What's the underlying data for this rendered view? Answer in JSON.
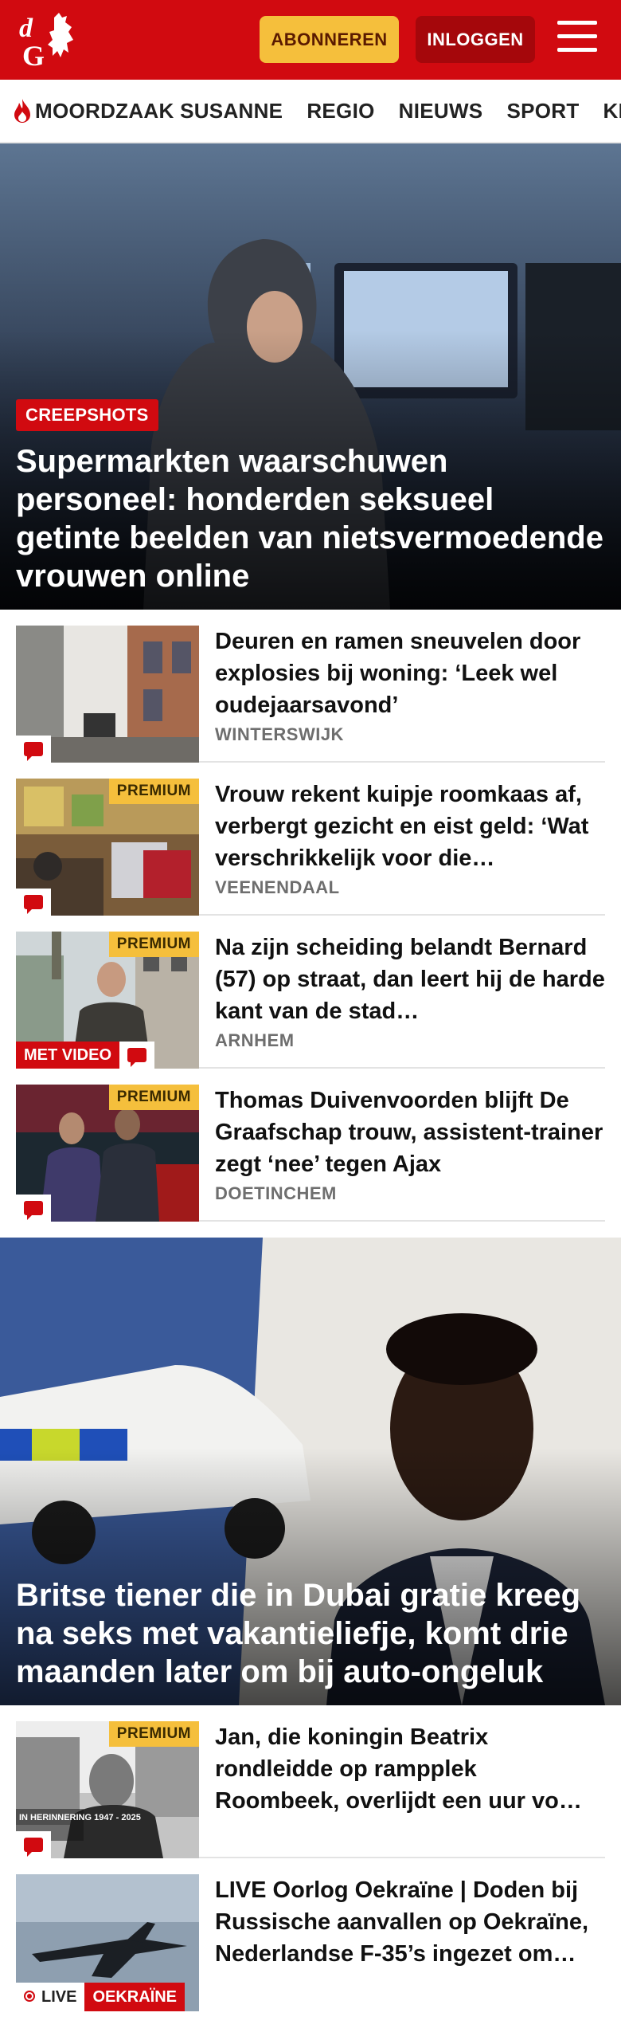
{
  "header": {
    "subscribe_label": "ABONNEREN",
    "login_label": "INLOGGEN",
    "brand_color": "#d10a10",
    "subscribe_color": "#f5bf3c"
  },
  "nav": {
    "items": [
      "MOORDZAAK SUSANNE",
      "REGIO",
      "NIEUWS",
      "SPORT",
      "KIJK"
    ]
  },
  "hero": {
    "tag": "CREEPSHOTS",
    "title": "Supermarkten waarschuwen personeel: honderden seksueel getinte beelden van nietsvermoeden­de vrouwen online"
  },
  "articles": [
    {
      "title": "Deuren en ramen sneuvelen door explosies bij woning: ‘Leek wel oudejaarsavond’",
      "location": "WINTERSWIJK",
      "premium": "",
      "video": ""
    },
    {
      "title": "Vrouw rekent kuipje roomkaas af, verbergt gezicht en eist geld: ‘Wat verschrikkelijk voor die…",
      "location": "VEENENDAAL",
      "premium": "PREMIUM",
      "video": ""
    },
    {
      "title": "Na zijn scheiding belandt Bernard (57) op straat, dan leert hij de harde kant van de stad…",
      "location": "ARNHEM",
      "premium": "PREMIUM",
      "video": "MET VIDEO"
    },
    {
      "title": "Thomas Duivenvoorden blijft De Graafschap trouw, assistent-trai­ner zegt ‘nee’ tegen Ajax",
      "location": "DOETINCHEM",
      "premium": "PREMIUM",
      "video": ""
    }
  ],
  "hero2": {
    "title": "Britse tiener die in Dubai gratie kreeg na seks met vakantieliefje, komt drie maanden later om bij auto-ongeluk"
  },
  "articles2": [
    {
      "title": "Jan, die koningin Beatrix rondleidde op rampplek Roombeek, overlijdt een uur vo…",
      "premium": "PREMIUM",
      "memorial": "IN HERINNERING 1947 - 2025"
    },
    {
      "title": "LIVE Oorlog Oekraïne | Doden bij Russische aanvallen op Oekraïne, Nederlandse F-35’s ingezet om…",
      "live": "LIVE",
      "topic": "OEKRAÏNE"
    }
  ]
}
